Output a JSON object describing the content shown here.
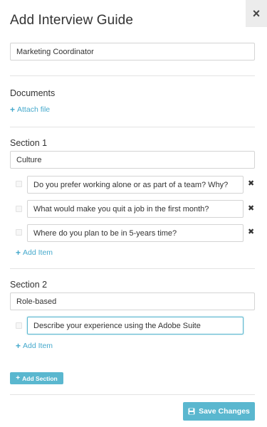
{
  "modal": {
    "title": "Add Interview Guide",
    "close_icon": "×",
    "name_value": "Marketing Coordinator"
  },
  "documents": {
    "heading": "Documents",
    "attach_label": "Attach file"
  },
  "sections": [
    {
      "heading": "Section 1",
      "name_value": "Culture",
      "items": [
        "Do you prefer working alone or as part of a team? Why?",
        "What would make you quit a job in the first month?",
        "Where do you plan to be in 5-years time?"
      ],
      "add_item_label": "Add Item"
    },
    {
      "heading": "Section 2",
      "name_value": "Role-based",
      "items": [
        "Describe your experience using the Adobe Suite"
      ],
      "add_item_label": "Add Item"
    }
  ],
  "actions": {
    "add_section_label": "Add Section",
    "save_label": "Save Changes"
  },
  "icons": {
    "close": "close-icon",
    "plus": "plus-icon",
    "remove": "remove-icon",
    "save": "floppy-disk-icon"
  },
  "colors": {
    "accent": "#5ab7cf",
    "link": "#45a9cc",
    "divider": "#e3e3e3",
    "close_tab_bg": "#ececec"
  }
}
